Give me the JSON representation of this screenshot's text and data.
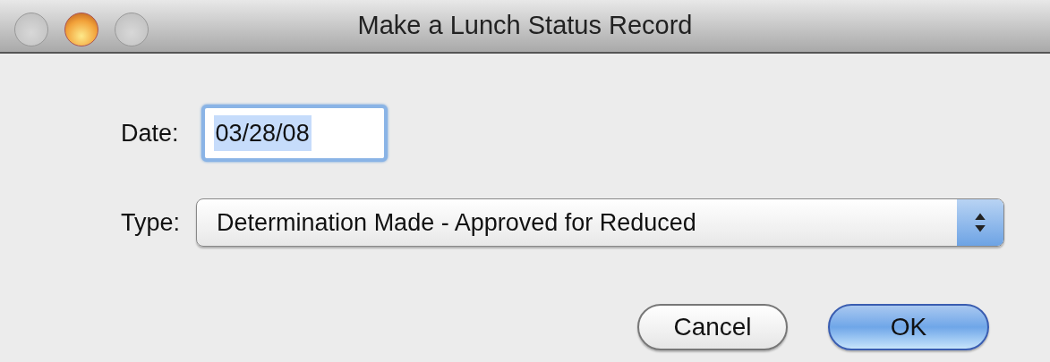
{
  "window": {
    "title": "Make a Lunch Status Record",
    "buttons": [
      {
        "enabled": false
      },
      {
        "enabled": true
      },
      {
        "enabled": false
      }
    ]
  },
  "date": {
    "label": "Date:",
    "value": "03/28/08",
    "focused": true
  },
  "type": {
    "label": "Type:",
    "value": "Determination Made - Approved for Reduced"
  },
  "buttons": [
    {
      "label": "Cancel",
      "default": false
    },
    {
      "label": "OK",
      "default": true
    }
  ]
}
